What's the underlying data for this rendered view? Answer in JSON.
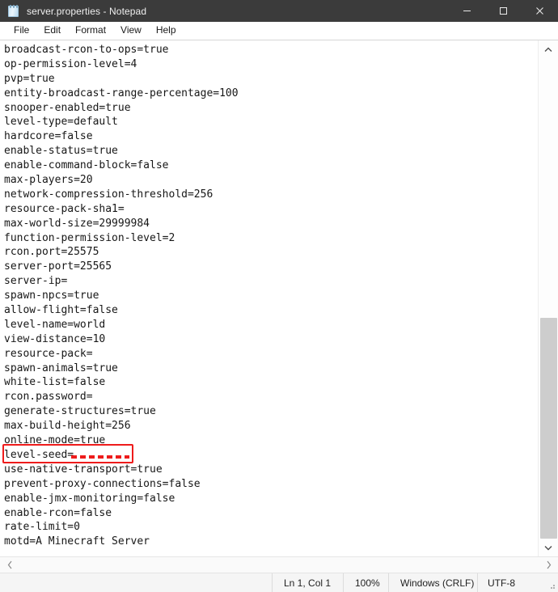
{
  "window": {
    "title": "server.properties - Notepad",
    "icon": "notepad-icon",
    "controls": {
      "minimize": "─",
      "maximize": "□",
      "close": "✕"
    }
  },
  "menubar": {
    "items": [
      {
        "label": "File"
      },
      {
        "label": "Edit"
      },
      {
        "label": "Format"
      },
      {
        "label": "View"
      },
      {
        "label": "Help"
      }
    ]
  },
  "editor": {
    "lines": [
      "broadcast-rcon-to-ops=true",
      "op-permission-level=4",
      "pvp=true",
      "entity-broadcast-range-percentage=100",
      "snooper-enabled=true",
      "level-type=default",
      "hardcore=false",
      "enable-status=true",
      "enable-command-block=false",
      "max-players=20",
      "network-compression-threshold=256",
      "resource-pack-sha1=",
      "max-world-size=29999984",
      "function-permission-level=2",
      "rcon.port=25575",
      "server-port=25565",
      "server-ip=",
      "spawn-npcs=true",
      "allow-flight=false",
      "level-name=world",
      "view-distance=10",
      "resource-pack=",
      "spawn-animals=true",
      "white-list=false",
      "rcon.password=",
      "generate-structures=true",
      "max-build-height=256",
      "online-mode=true",
      "level-seed=",
      "use-native-transport=true",
      "prevent-proxy-connections=false",
      "enable-jmx-monitoring=false",
      "enable-rcon=false",
      "rate-limit=0",
      "motd=A Minecraft Server"
    ],
    "annotation": {
      "target_line": "level-seed=",
      "color": "#ee1b1b",
      "style": "red-rectangle-with-dashes"
    }
  },
  "scrollbars": {
    "vertical": {
      "up_arrow": "˄",
      "down_arrow": "˅"
    },
    "horizontal": {
      "left_arrow": "‹",
      "right_arrow": "›"
    }
  },
  "statusbar": {
    "position": "Ln 1, Col 1",
    "zoom": "100%",
    "line_ending": "Windows (CRLF)",
    "encoding": "UTF-8"
  }
}
